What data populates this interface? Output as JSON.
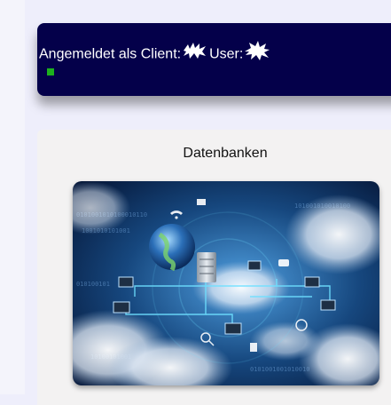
{
  "header": {
    "client_label": "Angemeldet als Client:",
    "user_label": "User:",
    "status_color": "#1db11d"
  },
  "card": {
    "title": "Datenbanken",
    "image_icon": "database-cloud-network-image"
  }
}
